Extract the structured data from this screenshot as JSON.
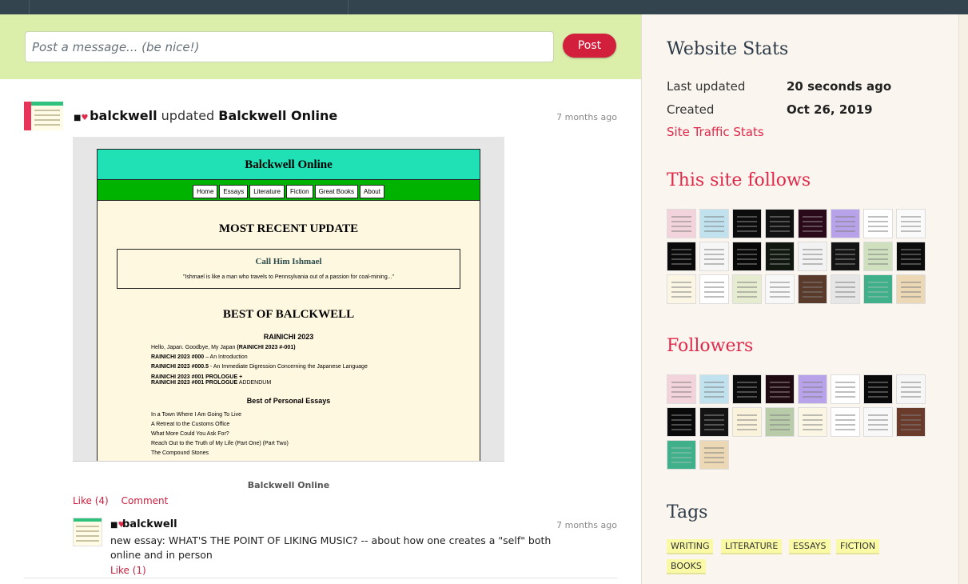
{
  "post_box": {
    "placeholder": "Post a message... (be nice!)",
    "button": "Post"
  },
  "event": {
    "user": "balckwell",
    "action": "updated",
    "site_name": "Balckwell Online",
    "time": "7 months ago",
    "caption": "Balckwell Online",
    "like": "Like (4)",
    "comment": "Comment",
    "screenshot": {
      "title": "Balckwell Online",
      "nav": [
        "Home",
        "Essays",
        "Literature",
        "Fiction",
        "Great Books",
        "About"
      ],
      "recent_heading": "MOST RECENT UPDATE",
      "recent_title": "Call Him Ishmael",
      "recent_quote": "\"Ishmael is like a man who travels to Pennsylvania out of a passion for coal-mining...\"",
      "best_heading": "BEST OF BALCKWELL",
      "rainichi_heading": "RAINICHI 2023",
      "rainichi_1_text": "Hello, Japan. Goodbye, My Japan ",
      "rainichi_1_bold": "(RAINICHI 2023 #-001)",
      "rainichi_2_bold": "RAINICHI 2023 #000",
      "rainichi_2_text": " – An Introduction",
      "rainichi_3_bold": "RAINICHI 2023 #000.5",
      "rainichi_3_text": " - An Immediate Digression Concerning the Japanese Language",
      "rainichi_4_bold": "RAINICHI 2023 #001 PROLOGUE +",
      "rainichi_5_bold": "RAINICHI 2023 #001 PROLOGUE",
      "rainichi_5_text": " ADDENDUM",
      "essays_heading": "Best of Personal Essays",
      "essay_1": "In a Town Where I Am Going To Live",
      "essay_2": "A Retreat to the Customs Office",
      "essay_3": "What More Could You Ask For?",
      "essay_4": "Reach Out to the Truth of My Life (Part One) (Part Two)",
      "essay_5": "The Compound Stones"
    }
  },
  "comment": {
    "user": "balckwell",
    "time": "7 months ago",
    "text": "new essay: WHAT'S THE POINT OF LIKING MUSIC? -- about how one creates a \"self\" both online and in person",
    "like": "Like (1)"
  },
  "sidebar": {
    "stats_heading": "Website Stats",
    "last_updated_label": "Last updated",
    "last_updated_value": "20 seconds ago",
    "created_label": "Created",
    "created_value": "Oct 26, 2019",
    "traffic_link": "Site Traffic Stats",
    "follows_heading": "This site follows",
    "followers_heading": "Followers",
    "tags_heading": "Tags",
    "tags": [
      "WRITING",
      "LITERATURE",
      "ESSAYS",
      "FICTION",
      "BOOKS"
    ],
    "follows_tiles": [
      "#f4d4dc",
      "#bfe2ee",
      "#0c0c0c",
      "#111111",
      "#2a0a18",
      "#b8a2ea",
      "#ffffff",
      "#fafafa",
      "#0a0a0a",
      "#f6f6f6",
      "#080808",
      "#101810",
      "#f2f2f2",
      "#141414",
      "#cfe0bf",
      "#0c0c0c",
      "#fbf6e4",
      "#ffffff",
      "#e6eccf",
      "#f8f8f8",
      "#5a3a2a",
      "#e6e6e6",
      "#3fb08a",
      "#ecd8b4"
    ],
    "followers_tiles": [
      "#f4d4dc",
      "#bfe2ee",
      "#0c0c0c",
      "#200a12",
      "#b8a2ea",
      "#ffffff",
      "#0a0a0a",
      "#f6f6f6",
      "#0a0a0a",
      "#141414",
      "#fbf2dc",
      "#b8ccaa",
      "#fbf6e4",
      "#ffffff",
      "#f8f8f8",
      "#6a3a2a",
      "#3fb08a",
      "#ecd8b4"
    ]
  }
}
